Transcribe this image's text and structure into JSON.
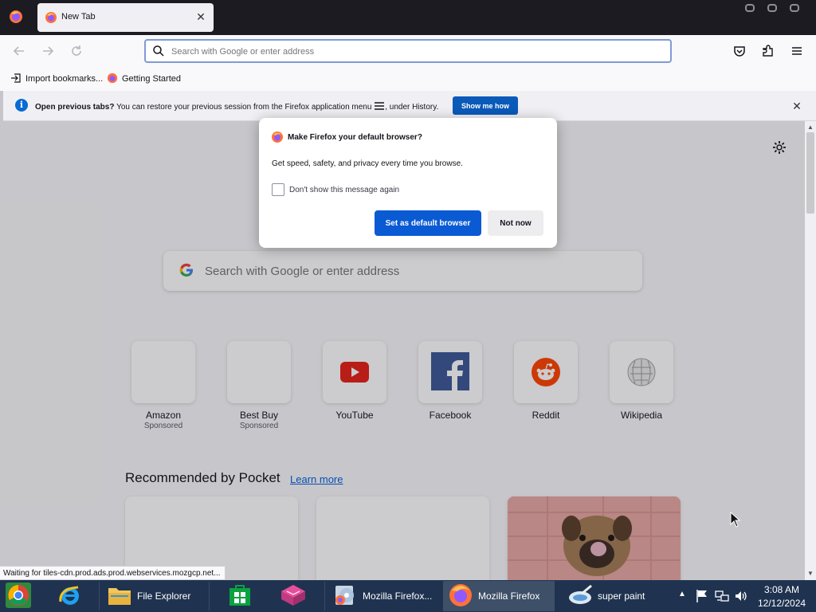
{
  "tab": {
    "title": "New Tab",
    "close_glyph": "✕"
  },
  "navbar": {
    "url_placeholder": "Search with Google or enter address"
  },
  "bookmarks": [
    {
      "label": "Import bookmarks..."
    },
    {
      "label": "Getting Started"
    }
  ],
  "infobar": {
    "bold": "Open previous tabs?",
    "text": " You can restore your previous session from the Firefox application menu ",
    "text_after": ", under History.",
    "button": "Show me how",
    "icon_glyph": "i",
    "close_glyph": "✕"
  },
  "dialog": {
    "title": "Make Firefox your default browser?",
    "body": "Get speed, safety, and privacy every time you browse.",
    "checkbox_label": "Don't show this message again",
    "checkbox_checked": false,
    "primary_button": "Set as default browser",
    "secondary_button": "Not now"
  },
  "newtab": {
    "search_placeholder": "Search with Google or enter address",
    "shortcuts": [
      {
        "label": "Amazon",
        "sub": "Sponsored",
        "icon": "blank"
      },
      {
        "label": "Best Buy",
        "sub": "Sponsored",
        "icon": "blank"
      },
      {
        "label": "YouTube",
        "sub": "",
        "icon": "youtube-icon"
      },
      {
        "label": "Facebook",
        "sub": "",
        "icon": "facebook-icon"
      },
      {
        "label": "Reddit",
        "sub": "",
        "icon": "reddit-icon"
      },
      {
        "label": "Wikipedia",
        "sub": "",
        "icon": "wikipedia-icon"
      }
    ],
    "pocket_title": "Recommended by Pocket",
    "pocket_learn_more": "Learn more"
  },
  "status_text": "Waiting for tiles-cdn.prod.ads.prod.webservices.mozgcp.net...",
  "taskbar": {
    "items": [
      {
        "label": "",
        "icon": "chrome-icon"
      },
      {
        "label": "",
        "icon": "internet-explorer-icon"
      },
      {
        "label": "File Explorer",
        "icon": "folder-icon"
      },
      {
        "label": "",
        "icon": "store-icon"
      },
      {
        "label": "",
        "icon": "app-icon"
      },
      {
        "label": "Mozilla Firefox...",
        "icon": "firefox-setup-icon"
      },
      {
        "label": "Mozilla Firefox",
        "icon": "firefox-icon",
        "active": true
      },
      {
        "label": "super paint",
        "icon": "paint-icon"
      }
    ],
    "time": "3:08 AM",
    "date": "12/12/2024"
  },
  "colors": {
    "accent": "#0a5ad4",
    "taskbar": "#1f3350",
    "tabbar": "#1c1b22"
  }
}
